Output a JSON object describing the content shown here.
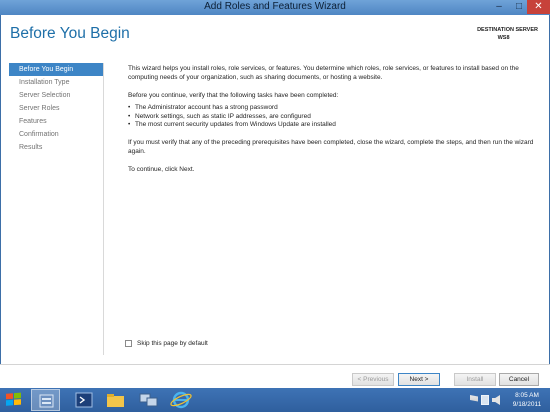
{
  "window": {
    "title": "Add Roles and Features Wizard",
    "minimize_glyph": "–",
    "maximize_glyph": "□",
    "close_glyph": "✕"
  },
  "header": {
    "page_title": "Before You Begin",
    "destination_label": "DESTINATION SERVER",
    "destination_server": "WS8"
  },
  "sidebar": {
    "items": [
      {
        "label": "Before You Begin",
        "active": true
      },
      {
        "label": "Installation Type",
        "active": false
      },
      {
        "label": "Server Selection",
        "active": false
      },
      {
        "label": "Server Roles",
        "active": false
      },
      {
        "label": "Features",
        "active": false
      },
      {
        "label": "Confirmation",
        "active": false
      },
      {
        "label": "Results",
        "active": false
      }
    ]
  },
  "content": {
    "intro": "This wizard helps you install roles, role services, or features. You determine which roles, role services, or features to install based on the computing needs of your organization, such as sharing documents, or hosting a website.",
    "verify_lead": "Before you continue, verify that the following tasks have been completed:",
    "tasks": [
      "The Administrator account has a strong password",
      "Network settings, such as static IP addresses, are configured",
      "The most current security updates from Windows Update are installed"
    ],
    "prereq_note": "If you must verify that any of the preceding prerequisites have been completed, close the wizard, complete the steps, and then run the wizard again.",
    "continue_note": "To continue, click Next."
  },
  "skip_checkbox": {
    "label": "Skip this page by default",
    "checked": false
  },
  "buttons": {
    "previous": "< Previous",
    "next": "Next >",
    "install": "Install",
    "cancel": "Cancel"
  },
  "taskbar": {
    "items": [
      "server-manager-icon",
      "powershell-icon",
      "file-explorer-icon",
      "network-icon",
      "internet-explorer-icon"
    ],
    "tray_icons": [
      "flag-icon",
      "network-status-icon",
      "volume-icon"
    ],
    "time": "8:05 AM",
    "date": "9/18/2011"
  },
  "colors": {
    "accent": "#3d85c6",
    "title_blue": "#1e6fa8",
    "taskbar": "#2f5f9e",
    "close": "#c7423a"
  }
}
